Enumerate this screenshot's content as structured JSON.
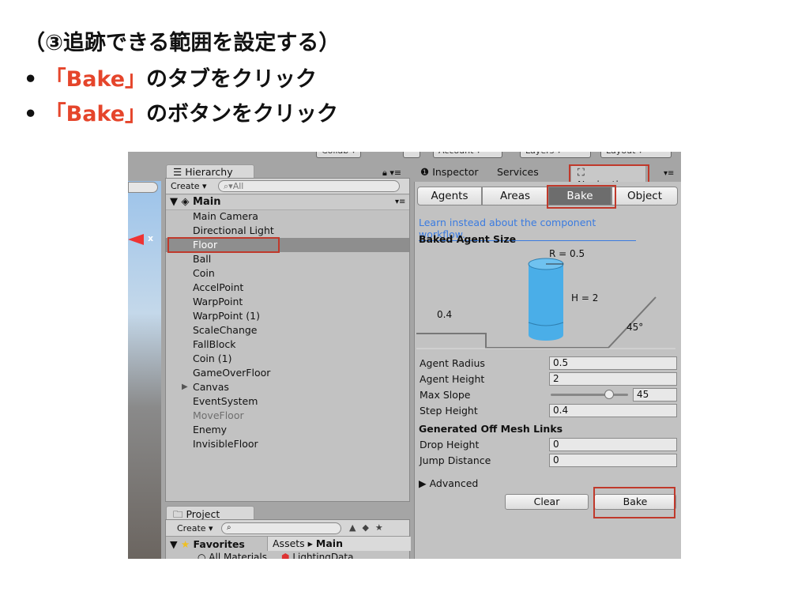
{
  "slide": {
    "heading": "（③追跡できる範囲を設定する）",
    "bullet1_key": "「Bake」",
    "bullet1_rest": "のタブをクリック",
    "bullet2_key": "「Bake」",
    "bullet2_rest": "のボタンをクリック",
    "bullet": "•"
  },
  "toolbar": {
    "collab": "Collab ▾",
    "account": "Account ▾",
    "layers": "Layers ▾",
    "layout": "Layout ▾"
  },
  "hierarchy": {
    "tab": "Hierarchy",
    "create": "Create ▾",
    "search_placeholder": "All",
    "scene": "Main",
    "items": [
      "Main Camera",
      "Directional Light",
      "Floor",
      "Ball",
      "Coin",
      "AccelPoint",
      "WarpPoint",
      "WarpPoint (1)",
      "ScaleChange",
      "FallBlock",
      "Coin (1)",
      "GameOverFloor",
      "Canvas",
      "EventSystem",
      "MoveFloor",
      "Enemy",
      "InvisibleFloor"
    ],
    "selected": "Floor",
    "disabled": "MoveFloor",
    "expandable": "Canvas"
  },
  "project": {
    "tab": "Project",
    "create": "Create ▾",
    "favorites": "Favorites",
    "favorite_item": "All Materials",
    "breadcrumb_root": "Assets",
    "breadcrumb_current": "Main",
    "asset": "LightingData"
  },
  "inspector": {
    "tabs": [
      "Inspector",
      "Services",
      "Navigation"
    ],
    "active_tab": "Navigation",
    "segments": [
      "Agents",
      "Areas",
      "Bake",
      "Object"
    ],
    "active_segment": "Bake",
    "link": "Learn instead about the component workflow.",
    "baked_agent_size": "Baked Agent Size",
    "diagram": {
      "radius": "R = 0.5",
      "height": "H = 2",
      "step": "0.4",
      "slope": "45°"
    },
    "fields": [
      {
        "label": "Agent Radius",
        "value": "0.5"
      },
      {
        "label": "Agent Height",
        "value": "2"
      },
      {
        "label": "Max Slope",
        "value": "45"
      },
      {
        "label": "Step Height",
        "value": "0.4"
      }
    ],
    "max_slope_fraction": 0.75,
    "offmesh_title": "Generated Off Mesh Links",
    "offmesh_fields": [
      {
        "label": "Drop Height",
        "value": "0"
      },
      {
        "label": "Jump Distance",
        "value": "0"
      }
    ],
    "advanced": "Advanced",
    "clear": "Clear",
    "bake": "Bake"
  },
  "colors": {
    "highlight": "#c0392b",
    "accent_red": "#e5452b",
    "link": "#3a7be0",
    "cylinder": "#4aaee8"
  }
}
